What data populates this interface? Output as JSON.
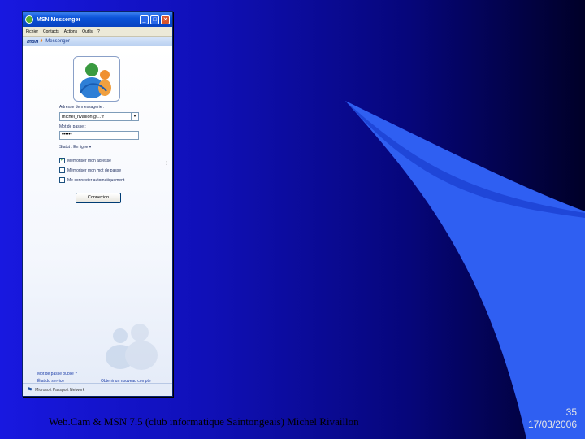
{
  "window": {
    "title": "MSN Messenger",
    "controls": [
      "_",
      "□",
      "✕"
    ],
    "menu": [
      "Fichier",
      "Contacts",
      "Actions",
      "Outils",
      "?"
    ],
    "brand_logo": "msn",
    "brand_text": "Messenger"
  },
  "login": {
    "email_label": "Adresse de messagerie :",
    "email_value": "michel_rivaillon@…fr",
    "password_label": "Mot de passe :",
    "password_value": "••••••",
    "status_label": "Statut : En ligne ▾",
    "checkboxes": [
      {
        "label": "Mémoriser mon adresse",
        "checked": true
      },
      {
        "label": "Mémoriser mon mot de passe",
        "checked": false
      },
      {
        "label": "Me connecter automatiquement",
        "checked": false
      }
    ],
    "connect_label": "Connexion"
  },
  "links": {
    "forgot_password": "Mot de passe oublié ?",
    "service_status": "État du service",
    "new_account": "Obtenir un nouveau compte"
  },
  "footer": {
    "text": "Microsoft Passport Network"
  },
  "slide": {
    "caption": "Web.Cam & MSN 7.5 (club informatique Saintongeais) Michel Rivaillon",
    "page_number": "35",
    "date": "17/03/2006"
  },
  "colors": {
    "background_left": "#1818e0",
    "background_right": "#000028",
    "swoosh": "#3060f0"
  }
}
